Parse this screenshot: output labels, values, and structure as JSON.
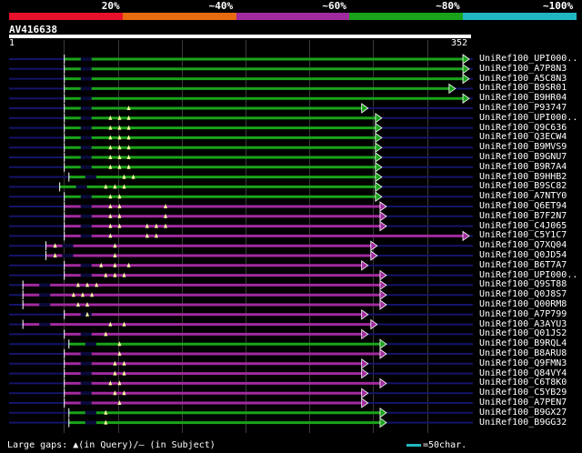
{
  "legend": [
    {
      "label": "20%",
      "color": "#e8102a"
    },
    {
      "label": "~40%",
      "color": "#e86a10"
    },
    {
      "label": "~60%",
      "color": "#a12a9e"
    },
    {
      "label": "~80%",
      "color": "#1aa31a"
    },
    {
      "label": "~100%",
      "color": "#20b7c2"
    }
  ],
  "query": {
    "id": "AV416638",
    "start": "1",
    "end": "352"
  },
  "hits": [
    {
      "label": "UniRef100_UPI000..",
      "color": "#1aa31a",
      "start": 0.12,
      "end": 1.0,
      "mid": "none",
      "dots": []
    },
    {
      "label": "UniRef100_A7P8N3",
      "color": "#1aa31a",
      "start": 0.12,
      "end": 1.0,
      "mid": "none",
      "dots": []
    },
    {
      "label": "UniRef100_A5C8N3",
      "color": "#1aa31a",
      "start": 0.12,
      "end": 1.0,
      "mid": "none",
      "dots": []
    },
    {
      "label": "UniRef100_B9SR01",
      "color": "#1aa31a",
      "start": 0.12,
      "end": 0.97,
      "mid": "none",
      "dots": []
    },
    {
      "label": "UniRef100_B9HR04",
      "color": "#1aa31a",
      "start": 0.12,
      "end": 1.0,
      "mid": "none",
      "dots": []
    },
    {
      "label": "UniRef100_P93747",
      "color": "#1aa31a",
      "start": 0.12,
      "end": 0.78,
      "mid": "none",
      "dots": [
        0.26
      ]
    },
    {
      "label": "UniRef100_UPI000..",
      "color": "#1aa31a",
      "start": 0.12,
      "end": 0.81,
      "mid": "none",
      "dots": [
        0.22,
        0.24,
        0.26
      ]
    },
    {
      "label": "UniRef100_Q9C636",
      "color": "#1aa31a",
      "start": 0.12,
      "end": 0.81,
      "mid": "none",
      "dots": [
        0.22,
        0.24,
        0.26
      ]
    },
    {
      "label": "UniRef100_Q3ECW4",
      "color": "#1aa31a",
      "start": 0.12,
      "end": 0.81,
      "mid": "none",
      "dots": [
        0.22,
        0.24,
        0.26
      ]
    },
    {
      "label": "UniRef100_B9MVS9",
      "color": "#1aa31a",
      "start": 0.12,
      "end": 0.81,
      "mid": "none",
      "dots": [
        0.22,
        0.24,
        0.26
      ]
    },
    {
      "label": "UniRef100_B9GNU7",
      "color": "#1aa31a",
      "start": 0.12,
      "end": 0.81,
      "mid": "none",
      "dots": [
        0.22,
        0.24,
        0.26
      ]
    },
    {
      "label": "UniRef100_B9R7A4",
      "color": "#1aa31a",
      "start": 0.12,
      "end": 0.81,
      "mid": "none",
      "dots": [
        0.22,
        0.24,
        0.26
      ]
    },
    {
      "label": "UniRef100_B9HHB2",
      "color": "#1aa31a",
      "start": 0.13,
      "end": 0.81,
      "mid": "none",
      "dots": [
        0.25,
        0.27
      ]
    },
    {
      "label": "UniRef100_B9SC82",
      "color": "#1aa31a",
      "start": 0.11,
      "end": 0.81,
      "mid": "none",
      "dots": [
        0.21,
        0.23,
        0.25
      ]
    },
    {
      "label": "UniRef100_A7NTY0",
      "color": "#1aa31a",
      "start": 0.12,
      "end": 0.81,
      "mid": "none",
      "dots": [
        0.22,
        0.24
      ]
    },
    {
      "label": "UniRef100_Q6ET94",
      "color": "#a12a9e",
      "start": 0.12,
      "end": 0.82,
      "mid": "none",
      "dots": [
        0.22,
        0.24,
        0.34
      ]
    },
    {
      "label": "UniRef100_B7F2N7",
      "color": "#a12a9e",
      "start": 0.12,
      "end": 0.82,
      "mid": "none",
      "dots": [
        0.22,
        0.24,
        0.34
      ]
    },
    {
      "label": "UniRef100_C4J065",
      "color": "#a12a9e",
      "start": 0.12,
      "end": 0.82,
      "mid": "none",
      "dots": [
        0.22,
        0.24,
        0.3,
        0.32,
        0.34
      ]
    },
    {
      "label": "UniRef100_C5Y1C7",
      "color": "#a12a9e",
      "start": 0.12,
      "end": 1.0,
      "mid": "none",
      "dots": [
        0.22,
        0.3,
        0.32
      ]
    },
    {
      "label": "UniRef100_Q7XQ04",
      "color": "#a12a9e",
      "start": 0.08,
      "end": 0.8,
      "mid": "none",
      "dots": [
        0.1,
        0.23
      ]
    },
    {
      "label": "UniRef100_Q0JD54",
      "color": "#a12a9e",
      "start": 0.08,
      "end": 0.8,
      "mid": "none",
      "dots": [
        0.1,
        0.23
      ]
    },
    {
      "label": "UniRef100_B6T7A7",
      "color": "#a12a9e",
      "start": 0.12,
      "end": 0.78,
      "mid": "none",
      "dots": [
        0.2,
        0.23,
        0.26
      ]
    },
    {
      "label": "UniRef100_UPI000..",
      "color": "#a12a9e",
      "start": 0.12,
      "end": 0.82,
      "mid": "none",
      "dots": [
        0.21,
        0.23,
        0.25
      ]
    },
    {
      "label": "UniRef100_Q9ST88",
      "color": "#a12a9e",
      "start": 0.03,
      "end": 0.82,
      "mid": "none",
      "dots": [
        0.15,
        0.17,
        0.19
      ]
    },
    {
      "label": "UniRef100_Q0J8S7",
      "color": "#a12a9e",
      "start": 0.03,
      "end": 0.82,
      "mid": "none",
      "dots": [
        0.14,
        0.16,
        0.18
      ]
    },
    {
      "label": "UniRef100_Q00RM8",
      "color": "#a12a9e",
      "start": 0.03,
      "end": 0.82,
      "mid": "none",
      "dots": [
        0.15,
        0.17
      ]
    },
    {
      "label": "UniRef100_A7P799",
      "color": "#a12a9e",
      "start": 0.12,
      "end": 0.78,
      "mid": "none",
      "dots": [
        0.17
      ]
    },
    {
      "label": "UniRef100_A3AYU3",
      "color": "#a12a9e",
      "start": 0.03,
      "end": 0.8,
      "mid": "none",
      "dots": [
        0.22,
        0.25
      ]
    },
    {
      "label": "UniRef100_Q01JS2",
      "color": "#a12a9e",
      "start": 0.12,
      "end": 0.78,
      "mid": "none",
      "dots": [
        0.21
      ]
    },
    {
      "label": "UniRef100_B9RQL4",
      "color": "#1aa31a",
      "start": 0.13,
      "end": 0.82,
      "mid": "none",
      "dots": [
        0.24
      ]
    },
    {
      "label": "UniRef100_B8ARU8",
      "color": "#a12a9e",
      "start": 0.12,
      "end": 0.82,
      "mid": "none",
      "dots": [
        0.24
      ]
    },
    {
      "label": "UniRef100_Q9FMN3",
      "color": "#a12a9e",
      "start": 0.12,
      "end": 0.78,
      "mid": "none",
      "dots": [
        0.23,
        0.25
      ]
    },
    {
      "label": "UniRef100_Q84VY4",
      "color": "#a12a9e",
      "start": 0.12,
      "end": 0.78,
      "mid": "none",
      "dots": [
        0.23,
        0.25
      ]
    },
    {
      "label": "UniRef100_C6T8K0",
      "color": "#a12a9e",
      "start": 0.12,
      "end": 0.82,
      "mid": "none",
      "dots": [
        0.22,
        0.24
      ]
    },
    {
      "label": "UniRef100_C5YB29",
      "color": "#a12a9e",
      "start": 0.12,
      "end": 0.78,
      "mid": "none",
      "dots": [
        0.23,
        0.25
      ]
    },
    {
      "label": "UniRef100_A7PEN7",
      "color": "#a12a9e",
      "start": 0.12,
      "end": 0.78,
      "mid": "none",
      "dots": [
        0.24
      ]
    },
    {
      "label": "UniRef100_B9GX27",
      "color": "#1aa31a",
      "start": 0.13,
      "end": 0.82,
      "mid": "none",
      "dots": [
        0.21
      ]
    },
    {
      "label": "UniRef100_B9GG32",
      "color": "#1aa31a",
      "start": 0.13,
      "end": 0.82,
      "mid": "none",
      "dots": [
        0.21
      ]
    }
  ],
  "footer": {
    "large_gaps": "Large gaps: ▲(in Query)/– (in Subject)",
    "scale_label": "=50char.",
    "scale_color": "#20b7c2"
  }
}
